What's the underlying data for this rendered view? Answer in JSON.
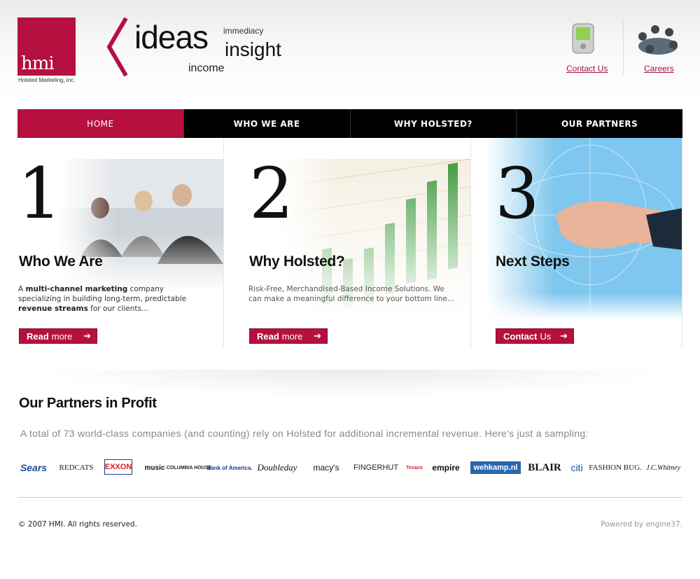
{
  "header": {
    "logo_text": "hmi",
    "logo_sub": "Holsted Marketing, inc.",
    "tagline": {
      "ideas": "ideas",
      "immediacy": "immediacy",
      "insight": "insight",
      "income": "income"
    },
    "links": {
      "contact": "Contact Us",
      "careers": "Careers"
    }
  },
  "nav": {
    "items": [
      {
        "label": "HOME",
        "active": true
      },
      {
        "label": "WHO WE ARE",
        "active": false
      },
      {
        "label": "WHY HOLSTED?",
        "active": false
      },
      {
        "label": "OUR PARTNERS",
        "active": false
      }
    ]
  },
  "features": [
    {
      "number": "1",
      "title": "Who We Are",
      "desc_1": "A ",
      "desc_b1": "multi-channel marketing",
      "desc_2": " company specializing in building long-term, predictable ",
      "desc_b2": "revenue streams",
      "desc_3": " for our clients...",
      "btn_strong": "Read",
      "btn_rest": "more"
    },
    {
      "number": "2",
      "title": "Why Holsted?",
      "desc": "Risk-Free, Merchandised-Based Income Solutions. We can make a meaningful difference to your bottom line...",
      "btn_strong": "Read",
      "btn_rest": "more"
    },
    {
      "number": "3",
      "title": "Next Steps",
      "btn_strong": "Contact",
      "btn_rest": "Us"
    }
  ],
  "partners": {
    "title": "Our Partners in Profit",
    "intro": "A total of 73 world-class companies (and counting) rely on Holsted for additional incremental revenue. Here's just a sampling:",
    "logos": [
      "Sears",
      "REDCATS",
      "EXXON",
      "music",
      "COLUMBIA HOUSE",
      "Bank of America.",
      "Doubleday",
      "macy's",
      "FINGERHUT",
      "Texaco",
      "empire",
      "wehkamp.nl",
      "BLAIR",
      "citi",
      "FASHION BUG.",
      "J.C.Whitney"
    ]
  },
  "footer": {
    "copyright": "© 2007 HMI. All rights reserved.",
    "powered": "Powered by engine37."
  },
  "colors": {
    "brand": "#b5103f",
    "nav_bg": "#000000"
  }
}
